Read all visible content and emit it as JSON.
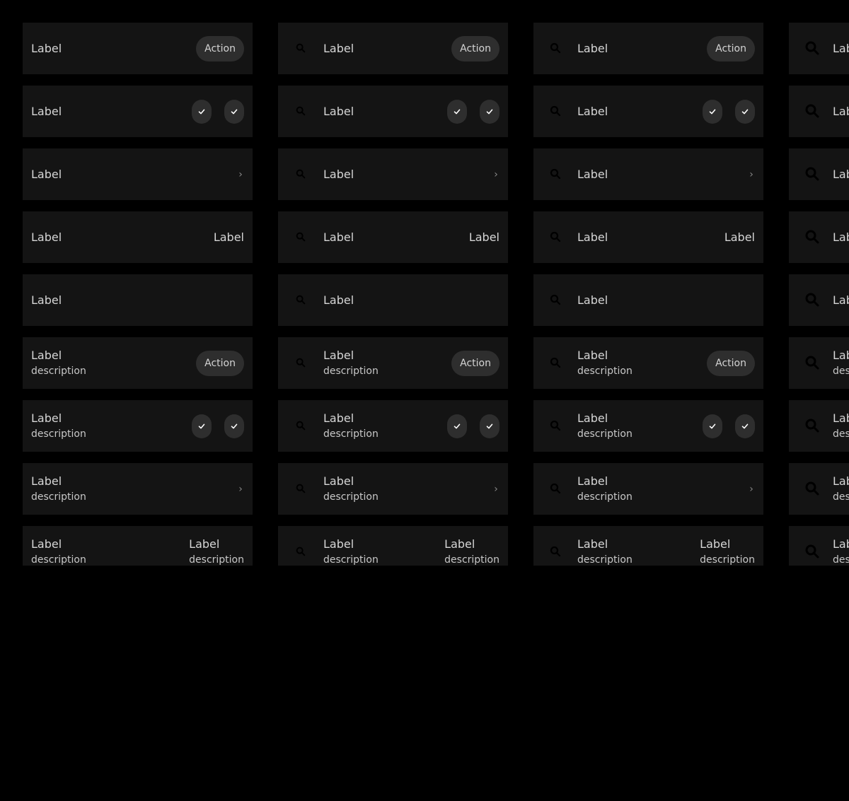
{
  "colors": {
    "background": "#000000",
    "item_background": "#141414",
    "button_background": "#2e2e2e",
    "text": "#d6d6d6",
    "icon": "#000000"
  },
  "icons": {
    "leading": "search-icon",
    "check": "check-icon",
    "chevron": "chevron-right-icon"
  },
  "rows": [
    {
      "label": "Label",
      "description": "",
      "trailing": "button",
      "action_label": "Action"
    },
    {
      "label": "Label",
      "description": "",
      "trailing": "checks"
    },
    {
      "label": "Label",
      "description": "",
      "trailing": "chevron",
      "chevron": "›"
    },
    {
      "label": "Label",
      "description": "",
      "trailing": "text",
      "value_label": "Label",
      "value_description": ""
    },
    {
      "label": "Label",
      "description": "",
      "trailing": "none"
    },
    {
      "label": "Label",
      "description": "description",
      "trailing": "button",
      "action_label": "Action"
    },
    {
      "label": "Label",
      "description": "description",
      "trailing": "checks"
    },
    {
      "label": "Label",
      "description": "description",
      "trailing": "chevron",
      "chevron": "›"
    },
    {
      "label": "Label",
      "description": "description",
      "trailing": "text",
      "value_label": "Label",
      "value_description": "description"
    }
  ]
}
